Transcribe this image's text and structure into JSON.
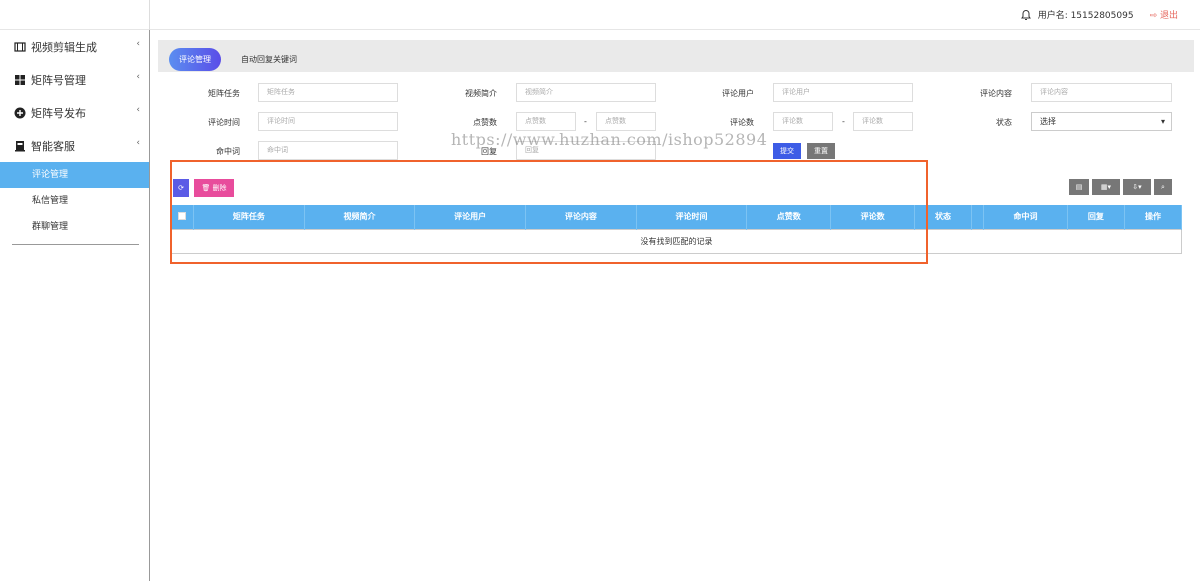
{
  "header": {
    "user_label": "用户名: 15152805095",
    "logout_label": "退出"
  },
  "sidebar": {
    "menus": [
      {
        "label": "视频剪辑生成",
        "icon": "film-icon"
      },
      {
        "label": "矩阵号管理",
        "icon": "grid-icon"
      },
      {
        "label": "矩阵号发布",
        "icon": "plus-circle-icon"
      },
      {
        "label": "智能客服",
        "icon": "service-icon"
      }
    ],
    "submenus": [
      "评论管理",
      "私信管理",
      "群聊管理"
    ]
  },
  "tabs": [
    "评论管理",
    "自动回复关键词"
  ],
  "filters": {
    "task_label": "矩阵任务",
    "task_ph": "矩阵任务",
    "intro_label": "视频简介",
    "intro_ph": "视频简介",
    "user_label": "评论用户",
    "user_ph": "评论用户",
    "content_label": "评论内容",
    "content_ph": "评论内容",
    "time_label": "评论时间",
    "time_ph": "评论时间",
    "likes_label": "点赞数",
    "likes_ph": "点赞数",
    "comments_label": "评论数",
    "comments_ph": "评论数",
    "status_label": "状态",
    "status_value": "选择",
    "hit_label": "命中词",
    "hit_ph": "命中词",
    "reply_label": "回复",
    "reply_ph": "回复",
    "range_sep": "-",
    "submit_label": "提交",
    "reset_label": "重置"
  },
  "watermark": "https://www.huzhan.com/ishop52894",
  "toolbar": {
    "delete_label": "删除"
  },
  "table": {
    "columns": [
      "矩阵任务",
      "视频简介",
      "评论用户",
      "评论内容",
      "评论时间",
      "点赞数",
      "评论数",
      "状态",
      "命中词",
      "回复",
      "操作"
    ],
    "empty_text": "没有找到匹配的记录"
  },
  "colors": {
    "accent": "#5ab1ef",
    "delete": "#e84c9c",
    "refresh": "#5b5be6",
    "highlight": "#f0622c"
  }
}
